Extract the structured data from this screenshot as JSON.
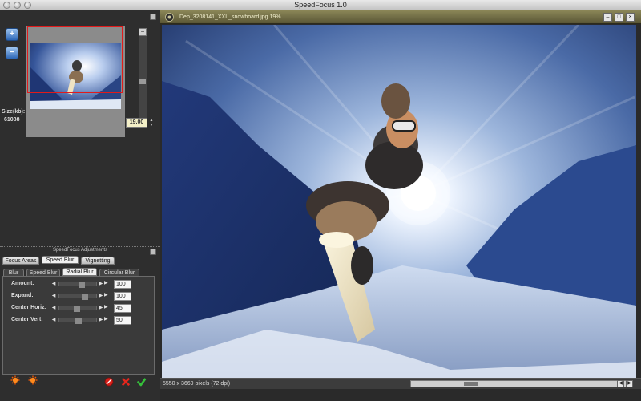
{
  "window": {
    "title": "SpeedFocus 1.0"
  },
  "preview": {
    "zoom_in_label": "+",
    "zoom_out_label": "−",
    "size_label": "Size(kb):",
    "size_value": "61088",
    "zoom_value": "19.00"
  },
  "adjustments": {
    "title": "SpeedFocus Adjustments",
    "main_tabs": [
      {
        "label": "Focus Areas",
        "active": false
      },
      {
        "label": "Speed Blur",
        "active": true
      },
      {
        "label": "Vignetting",
        "active": false
      }
    ],
    "sub_tabs": [
      {
        "label": "Blur",
        "active": false
      },
      {
        "label": "Speed Blur",
        "active": false
      },
      {
        "label": "Radial Blur",
        "active": true
      },
      {
        "label": "Circular Blur",
        "active": false
      }
    ],
    "rows": [
      {
        "label": "Amount:",
        "value": "100"
      },
      {
        "label": "Expand:",
        "value": "100"
      },
      {
        "label": "Center Horiz:",
        "value": "45"
      },
      {
        "label": "Center Vert:",
        "value": "50"
      }
    ]
  },
  "document": {
    "title": "Dep_3208141_XXL_snowboard.jpg 19%",
    "status": "5550 x 3669 pixels (72 dpi)"
  },
  "colors": {
    "accent_title": "#6b6744",
    "sky_dark": "#1b2f63",
    "sky_light": "#c9d9ef"
  }
}
